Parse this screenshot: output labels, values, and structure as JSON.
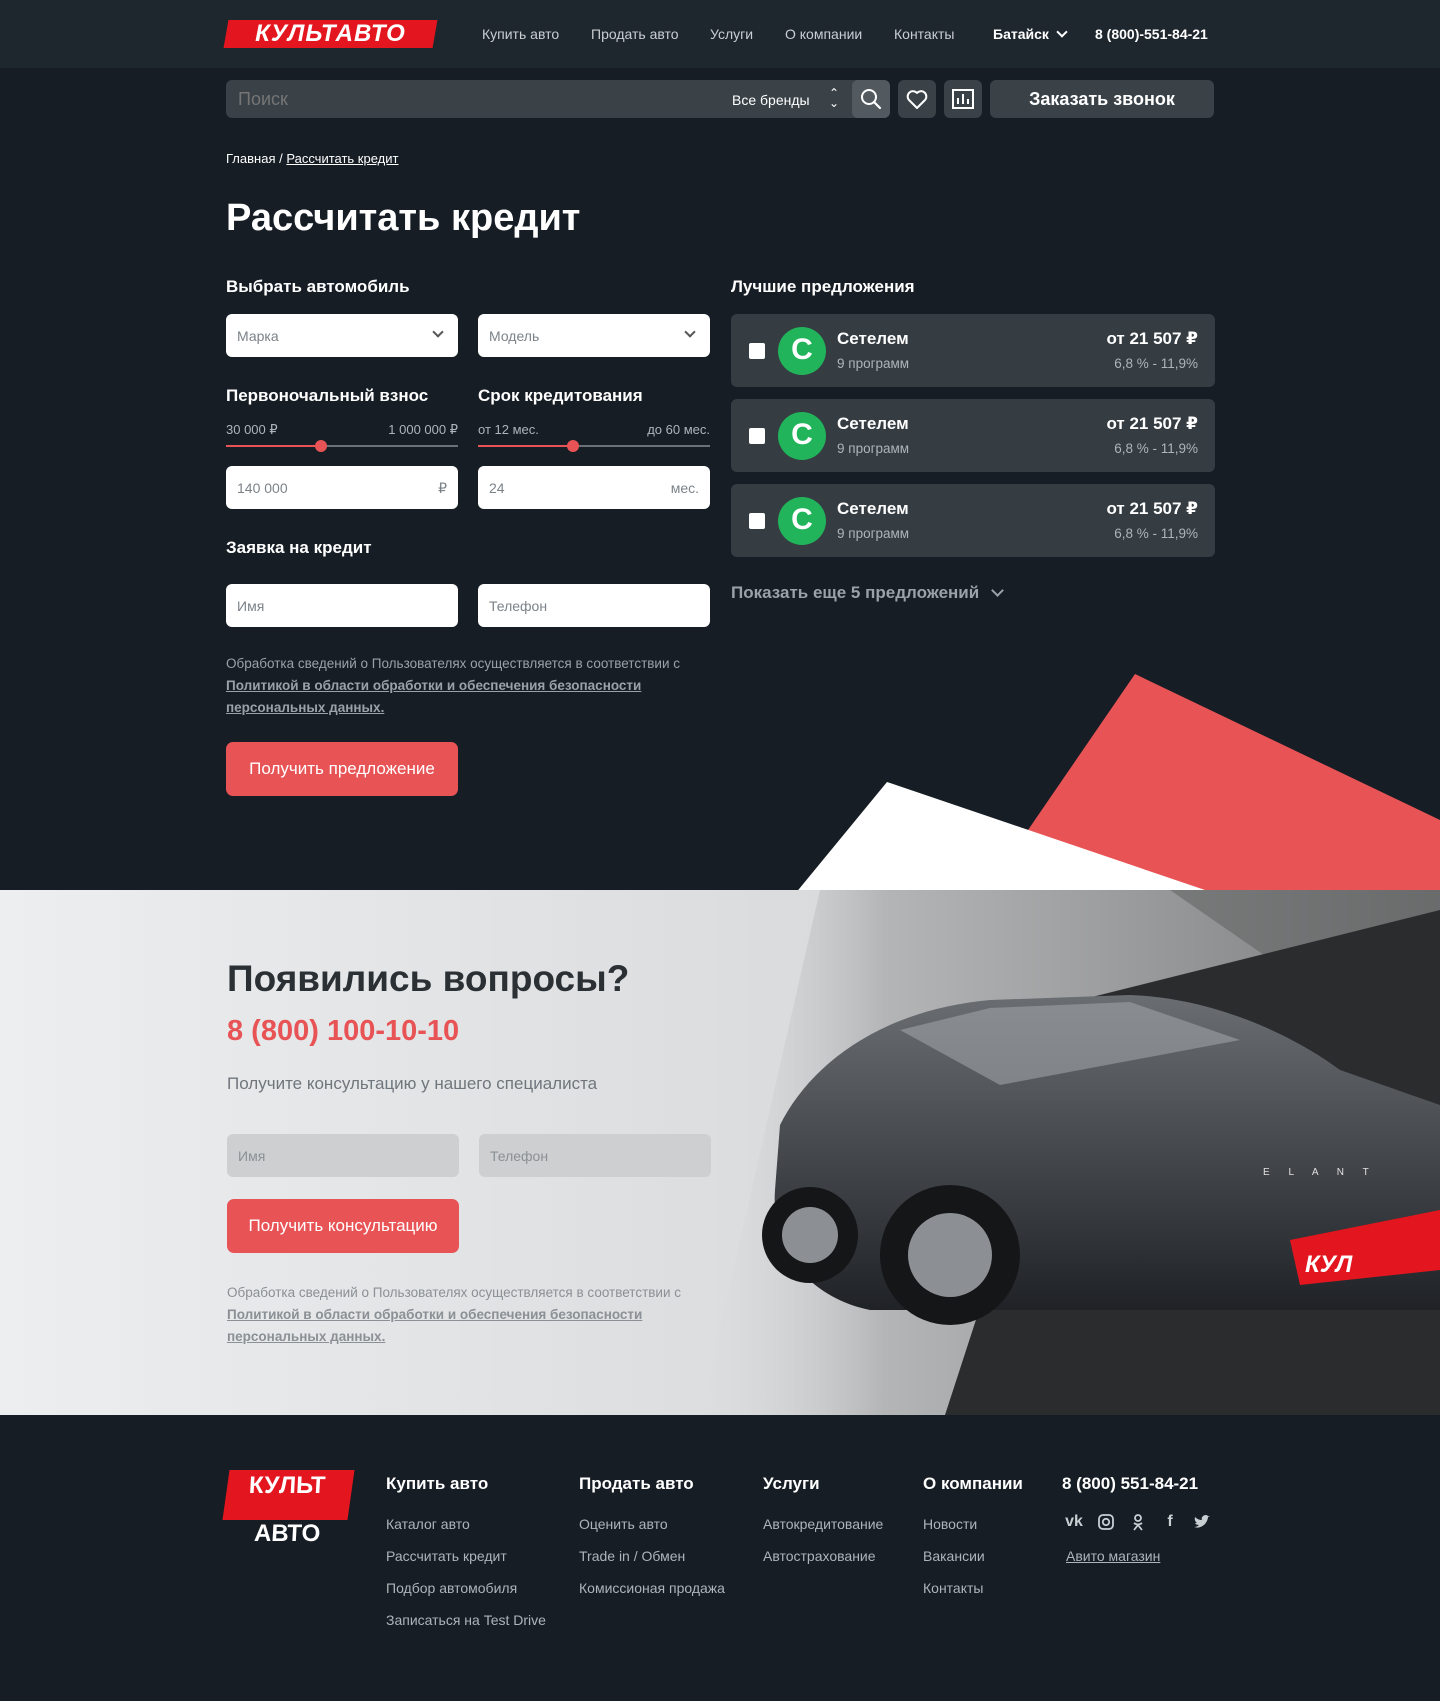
{
  "header": {
    "logo": "КУЛЬТАВТО",
    "nav": [
      "Купить авто",
      "Продать авто",
      "Услуги",
      "О компании",
      "Контакты"
    ],
    "city": "Батайск",
    "phone": "8 (800)-551-84-21"
  },
  "searchbar": {
    "placeholder": "Поиск",
    "brands": "Все бренды",
    "callback_button": "Заказать звонок"
  },
  "breadcrumb": {
    "home": "Главная",
    "separator": "/",
    "current": "Рассчитать кредит"
  },
  "page_title": "Рассчитать кредит",
  "calculator": {
    "choose_car": "Выбрать автомобиль",
    "brand_placeholder": "Марка",
    "model_placeholder": "Модель",
    "down_payment": {
      "label": "Первоночальный взнос",
      "min": "30 000 ₽",
      "max": "1 000 000 ₽",
      "value": "140 000",
      "unit": "₽",
      "fraction": 0.41
    },
    "term": {
      "label": "Срок кредитования",
      "min": "от 12 мес.",
      "max": "до 60 мес.",
      "value": "24",
      "unit": "мес.",
      "fraction": 0.41
    },
    "application": {
      "label": "Заявка на кредит",
      "name_placeholder": "Имя",
      "phone_placeholder": "Телефон",
      "note": "Обработка сведений о Пользователях осуществляется  в соответствии с",
      "policy_link": "Политикой в области обработки и обеспечения безопасности персональных данных.",
      "submit": "Получить предложение"
    }
  },
  "offers": {
    "title": "Лучшие предложения",
    "items": [
      {
        "bank": "Сетелем",
        "logo_letter": "С",
        "programs": "9 программ",
        "price": "от 21 507 ₽",
        "rate": "6,8 % - 11,9%"
      },
      {
        "bank": "Сетелем",
        "logo_letter": "С",
        "programs": "9 программ",
        "price": "от 21 507 ₽",
        "rate": "6,8 % - 11,9%"
      },
      {
        "bank": "Сетелем",
        "logo_letter": "С",
        "programs": "9 программ",
        "price": "от 21 507 ₽",
        "rate": "6,8 % - 11,9%"
      }
    ],
    "show_more": "Показать еще 5 предложений"
  },
  "questions": {
    "title": "Появились вопросы?",
    "phone": "8 (800) 100-10-10",
    "subtitle": "Получите консультацию у нашего специалиста",
    "name_placeholder": "Имя",
    "phone_placeholder": "Телефон",
    "submit": "Получить консультацию",
    "note": "Обработка сведений о Пользователях осуществляется  в соответствии с",
    "policy_link": "Политикой в области обработки и обеспечения безопасности персональных данных.",
    "car_badge": "КУЛ",
    "car_model": "E L A N T"
  },
  "footer": {
    "logo_line1": "КУЛЬТ",
    "logo_line2": "АВТО",
    "columns": [
      {
        "title": "Купить авто",
        "links": [
          "Каталог авто",
          "Рассчитать кредит",
          "Подбор автомобиля",
          "Записаться на Test Drive"
        ]
      },
      {
        "title": "Продать авто",
        "links": [
          "Оценить авто",
          "Trade in / Обмен",
          "Комиссионая продажа"
        ]
      },
      {
        "title": "Услуги",
        "links": [
          "Автокредитование",
          "Автострахование"
        ]
      },
      {
        "title": "О компании",
        "links": [
          "Новости",
          "Вакансии",
          "Контакты"
        ]
      }
    ],
    "phone": "8 (800) 551-84-21",
    "social": [
      "vk-icon",
      "instagram-icon",
      "odnoklassniki-icon",
      "facebook-icon",
      "twitter-icon"
    ],
    "avito": "Авито магазин"
  },
  "colors": {
    "accent": "#e85456",
    "brand_red": "#e3161f",
    "bg": "#161d24",
    "bank_green": "#21b45a"
  }
}
